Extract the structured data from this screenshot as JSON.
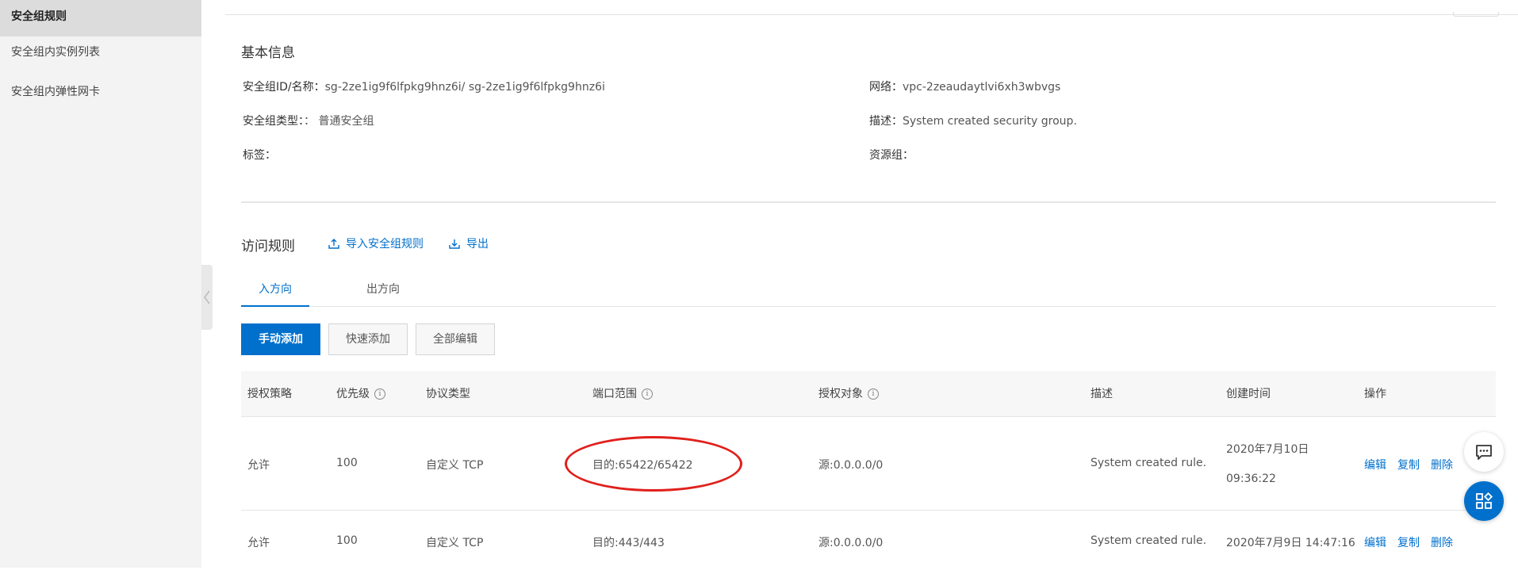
{
  "sidebar": {
    "items": [
      {
        "label": "安全组规则",
        "active": true
      },
      {
        "label": "安全组内实例列表",
        "active": false
      },
      {
        "label": "安全组内弹性网卡",
        "active": false
      }
    ]
  },
  "basic_info": {
    "title": "基本信息",
    "sg_id_label": "安全组ID/名称：",
    "sg_id_value": "sg-2ze1ig9f6lfpkg9hnz6i/ sg-2ze1ig9f6lfpkg9hnz6i",
    "network_label": "网络：",
    "network_value": "vpc-2zeaudaytlvi6xh3wbvgs",
    "type_label": "安全组类型：",
    "type_value": "：  普通安全组",
    "desc_label": "描述：",
    "desc_value": "System created security group.",
    "tags_label": "标签：",
    "resource_group_label": "资源组："
  },
  "access_rules": {
    "title": "访问规则",
    "import_label": "导入安全组规则",
    "export_label": "导出",
    "tabs": [
      {
        "label": "入方向",
        "active": true
      },
      {
        "label": "出方向",
        "active": false
      }
    ],
    "buttons": {
      "manual_add": "手动添加",
      "quick_add": "快速添加",
      "edit_all": "全部编辑"
    },
    "columns": [
      "授权策略",
      "优先级",
      "协议类型",
      "端口范围",
      "授权对象",
      "描述",
      "创建时间",
      "操作"
    ],
    "rows": [
      {
        "policy": "允许",
        "priority": "100",
        "protocol": "自定义 TCP",
        "port": "目的:65422/65422",
        "target": "源:0.0.0.0/0",
        "desc": "System created rule.",
        "created_date": "2020年7月10日",
        "created_time": "09:36:22",
        "actions": [
          "编辑",
          "复制",
          "删除"
        ]
      },
      {
        "policy": "允许",
        "priority": "100",
        "protocol": "自定义 TCP",
        "port": "目的:443/443",
        "target": "源:0.0.0.0/0",
        "desc": "System created rule.",
        "created": "2020年7月9日 14:47:16",
        "actions": [
          "编辑",
          "复制",
          "删除"
        ]
      }
    ]
  },
  "colors": {
    "accent": "#0070cc",
    "highlight": "#e0201c",
    "sidebar_bg": "#f3f3f3"
  },
  "icons": {
    "import": "upload-icon",
    "export": "download-icon",
    "info": "info-icon",
    "chat": "chat-icon",
    "apps": "apps-icon",
    "collapse": "chevron-left-icon"
  }
}
